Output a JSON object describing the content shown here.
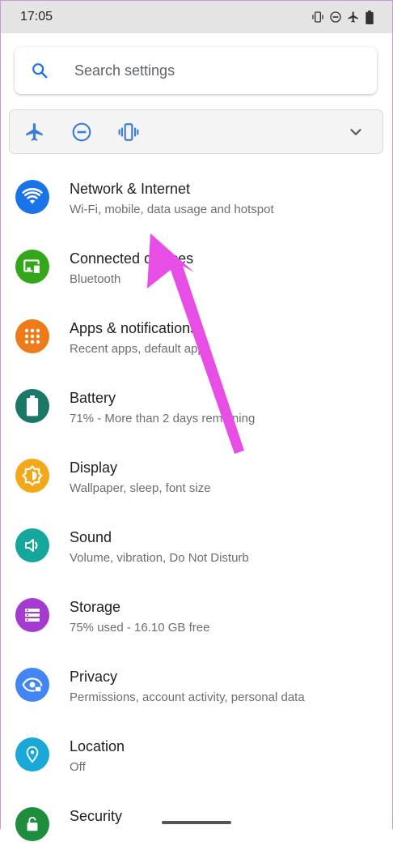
{
  "status_bar": {
    "time": "17:05",
    "icons": [
      "vibrate-icon",
      "do-not-disturb-icon",
      "airplane-icon",
      "battery-icon"
    ]
  },
  "search": {
    "placeholder": "Search settings"
  },
  "quick_settings": {
    "icons": [
      "airplane-icon",
      "do-not-disturb-icon",
      "vibrate-icon"
    ],
    "expand_icon": "chevron-down-icon"
  },
  "settings": [
    {
      "id": "network",
      "title": "Network & Internet",
      "subtitle": "Wi-Fi, mobile, data usage and hotspot",
      "icon": "wifi-icon",
      "color": "#1a73e8"
    },
    {
      "id": "connected-devices",
      "title": "Connected devices",
      "subtitle": "Bluetooth",
      "icon": "devices-icon",
      "color": "#34a61a"
    },
    {
      "id": "apps",
      "title": "Apps & notifications",
      "subtitle": "Recent apps, default apps",
      "icon": "apps-grid-icon",
      "color": "#f07a1a"
    },
    {
      "id": "battery",
      "title": "Battery",
      "subtitle": "71% - More than 2 days remaining",
      "icon": "battery-icon",
      "color": "#1a7867"
    },
    {
      "id": "display",
      "title": "Display",
      "subtitle": "Wallpaper, sleep, font size",
      "icon": "brightness-icon",
      "color": "#f2a818"
    },
    {
      "id": "sound",
      "title": "Sound",
      "subtitle": "Volume, vibration, Do Not Disturb",
      "icon": "volume-icon",
      "color": "#15a69c"
    },
    {
      "id": "storage",
      "title": "Storage",
      "subtitle": "75% used - 16.10 GB free",
      "icon": "storage-icon",
      "color": "#a53ad1"
    },
    {
      "id": "privacy",
      "title": "Privacy",
      "subtitle": "Permissions, account activity, personal data",
      "icon": "eye-icon",
      "color": "#4285f4"
    },
    {
      "id": "location",
      "title": "Location",
      "subtitle": "Off",
      "icon": "location-pin-icon",
      "color": "#1aa9d6"
    },
    {
      "id": "security",
      "title": "Security",
      "subtitle": "",
      "icon": "lock-icon",
      "color": "#1e8e3e"
    }
  ],
  "annotation": {
    "arrow_color": "#e64ee6"
  }
}
